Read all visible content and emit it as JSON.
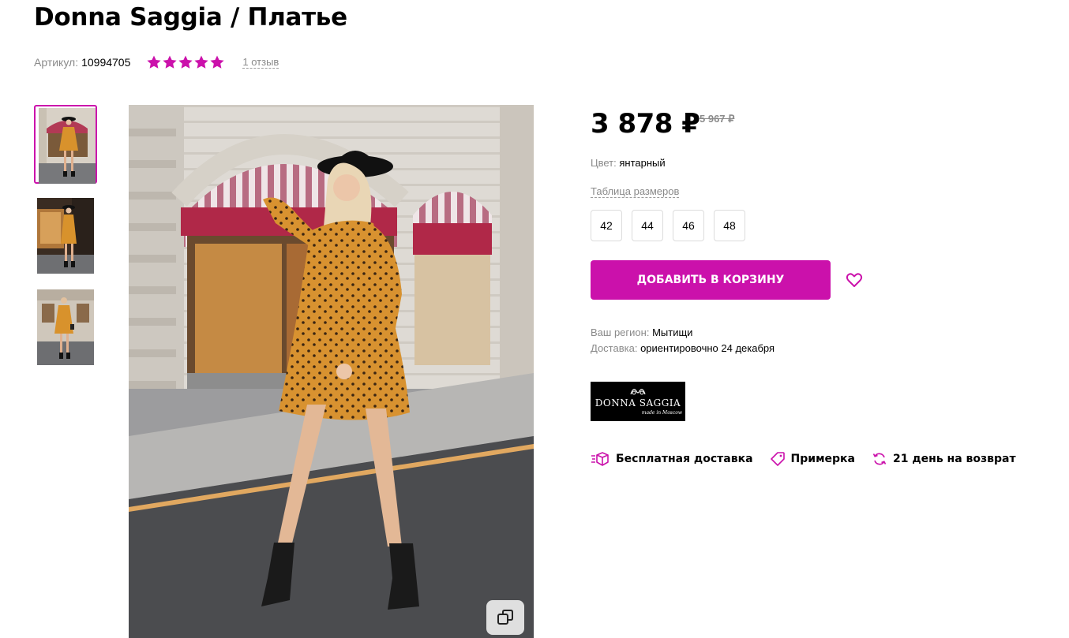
{
  "product": {
    "title": "Donna Saggia / Платье",
    "article_label": "Артикул:",
    "article_value": "10994705",
    "rating": 5,
    "reviews": "1 отзыв"
  },
  "gallery": {
    "thumb_count": 3,
    "active_index": 0,
    "zoom_icon": "expand-icon"
  },
  "price": {
    "current": "3 878 ₽",
    "old": "5 967 ₽"
  },
  "color": {
    "label": "Цвет:",
    "value": "янтарный"
  },
  "size_table_link": "Таблица размеров",
  "sizes": [
    "42",
    "44",
    "46",
    "48"
  ],
  "cart_button": "ДОБАВИТЬ В КОРЗИНУ",
  "favorite_icon": "heart-icon",
  "region": {
    "label": "Ваш регион:",
    "value": "Мытищи"
  },
  "delivery": {
    "label": "Доставка:",
    "value": "ориентировочно 24 декабря"
  },
  "brand": {
    "name": "DONNA SAGGIA",
    "tagline": "made in Moscow"
  },
  "features": [
    {
      "icon": "delivery-box-icon",
      "label": "Бесплатная доставка"
    },
    {
      "icon": "tag-icon",
      "label": "Примерка"
    },
    {
      "icon": "refresh-icon",
      "label": "21 день на возврат"
    }
  ],
  "colors": {
    "accent": "#cb11ab",
    "text_secondary": "#8a8a8a"
  }
}
